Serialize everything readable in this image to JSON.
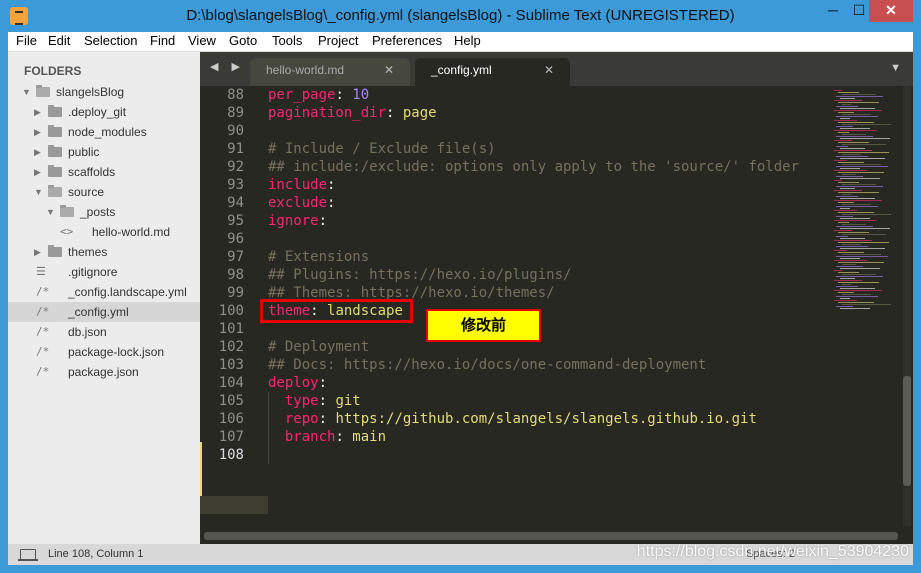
{
  "window": {
    "title": "D:\\blog\\slangelsBlog\\_config.yml (slangelsBlog) - Sublime Text (UNREGISTERED)",
    "min_label": "─",
    "max_label": "☐",
    "close_label": "✕"
  },
  "menu": [
    "File",
    "Edit",
    "Selection",
    "Find",
    "View",
    "Goto",
    "Tools",
    "Project",
    "Preferences",
    "Help"
  ],
  "sidebar": {
    "header": "FOLDERS",
    "items": [
      {
        "label": "slangelsBlog",
        "type": "folder-open",
        "depth": 0
      },
      {
        "label": ".deploy_git",
        "type": "folder",
        "depth": 1
      },
      {
        "label": "node_modules",
        "type": "folder",
        "depth": 1
      },
      {
        "label": "public",
        "type": "folder",
        "depth": 1
      },
      {
        "label": "scaffolds",
        "type": "folder",
        "depth": 1
      },
      {
        "label": "source",
        "type": "folder-open",
        "depth": 1
      },
      {
        "label": "_posts",
        "type": "folder-open",
        "depth": 2
      },
      {
        "label": "hello-world.md",
        "type": "file-code",
        "depth": 3
      },
      {
        "label": "themes",
        "type": "folder",
        "depth": 1
      },
      {
        "label": ".gitignore",
        "type": "file-text",
        "depth": 1
      },
      {
        "label": "_config.landscape.yml",
        "type": "file-comment",
        "depth": 1
      },
      {
        "label": "_config.yml",
        "type": "file-comment",
        "depth": 1,
        "selected": true
      },
      {
        "label": "db.json",
        "type": "file-comment",
        "depth": 1
      },
      {
        "label": "package-lock.json",
        "type": "file-comment",
        "depth": 1
      },
      {
        "label": "package.json",
        "type": "file-comment",
        "depth": 1
      }
    ]
  },
  "tabs": [
    {
      "label": "hello-world.md",
      "active": false
    },
    {
      "label": "_config.yml",
      "active": true
    }
  ],
  "nav_arrows": "◀ ▶",
  "tab_close": "✕",
  "dropdown_icon": "▼",
  "editor": {
    "lines": [
      {
        "n": "88",
        "parts": [
          {
            "t": "per_page",
            "c": "k"
          },
          {
            "t": ": "
          },
          {
            "t": "10",
            "c": "n"
          }
        ]
      },
      {
        "n": "89",
        "parts": [
          {
            "t": "pagination_dir",
            "c": "k"
          },
          {
            "t": ": "
          },
          {
            "t": "page",
            "c": "s"
          }
        ]
      },
      {
        "n": "90",
        "parts": []
      },
      {
        "n": "91",
        "parts": [
          {
            "t": "# Include / Exclude file(s)",
            "c": "c"
          }
        ]
      },
      {
        "n": "92",
        "parts": [
          {
            "t": "## include:/exclude: options only apply to the 'source/' folder",
            "c": "c"
          }
        ]
      },
      {
        "n": "93",
        "parts": [
          {
            "t": "include",
            "c": "k"
          },
          {
            "t": ":"
          }
        ]
      },
      {
        "n": "94",
        "parts": [
          {
            "t": "exclude",
            "c": "k"
          },
          {
            "t": ":"
          }
        ]
      },
      {
        "n": "95",
        "parts": [
          {
            "t": "ignore",
            "c": "k"
          },
          {
            "t": ":"
          }
        ]
      },
      {
        "n": "96",
        "parts": []
      },
      {
        "n": "97",
        "parts": [
          {
            "t": "# Extensions",
            "c": "c"
          }
        ]
      },
      {
        "n": "98",
        "parts": [
          {
            "t": "## Plugins: https://hexo.io/plugins/",
            "c": "c"
          }
        ]
      },
      {
        "n": "99",
        "parts": [
          {
            "t": "## Themes: https://hexo.io/themes/",
            "c": "c"
          }
        ]
      },
      {
        "n": "100",
        "parts": [
          {
            "t": "theme",
            "c": "k"
          },
          {
            "t": ": "
          },
          {
            "t": "landscape",
            "c": "s"
          }
        ]
      },
      {
        "n": "101",
        "parts": []
      },
      {
        "n": "102",
        "parts": [
          {
            "t": "# Deployment",
            "c": "c"
          }
        ]
      },
      {
        "n": "103",
        "parts": [
          {
            "t": "## Docs: https://hexo.io/docs/one-command-deployment",
            "c": "c"
          }
        ]
      },
      {
        "n": "104",
        "parts": [
          {
            "t": "deploy",
            "c": "k"
          },
          {
            "t": ":"
          }
        ]
      },
      {
        "n": "105",
        "parts": [
          {
            "t": "  "
          },
          {
            "t": "type",
            "c": "k"
          },
          {
            "t": ": "
          },
          {
            "t": "git",
            "c": "s"
          }
        ]
      },
      {
        "n": "106",
        "parts": [
          {
            "t": "  "
          },
          {
            "t": "repo",
            "c": "k"
          },
          {
            "t": ": "
          },
          {
            "t": "https://github.com/slangels/slangels.github.io.git",
            "c": "s"
          }
        ]
      },
      {
        "n": "107",
        "parts": [
          {
            "t": "  "
          },
          {
            "t": "branch",
            "c": "k"
          },
          {
            "t": ": "
          },
          {
            "t": "main",
            "c": "s"
          }
        ]
      },
      {
        "n": "108",
        "parts": []
      }
    ],
    "current_line": "108"
  },
  "annotation": "修改前",
  "status": {
    "position": "Line 108, Column 1",
    "right": "Spaces: 2"
  },
  "watermark": "https://blog.csdn.net/weixin_53904230",
  "colors": {
    "keyword": "#f92672",
    "number": "#ae81ff",
    "string": "#e6db74",
    "comment": "#75715e",
    "bg": "#272822",
    "highlight": "#e60000",
    "annotation_bg": "#ffff00"
  }
}
